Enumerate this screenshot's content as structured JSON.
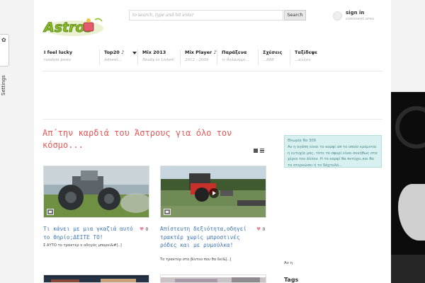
{
  "site": {
    "logo_text": "ASTROS"
  },
  "settings_tab": {
    "label": "Settings",
    "icon": "gear-icon"
  },
  "search": {
    "placeholder": "to search, type and hit enter",
    "button": "Search"
  },
  "account": {
    "signin": "sign in",
    "signin_sub": "comment area",
    "icon": "user-icon"
  },
  "nav": {
    "items": [
      {
        "label": "I feel lucky",
        "sub": "random posts"
      },
      {
        "label": "Top20 ♪",
        "sub": "Advent..."
      },
      {
        "label": "Mix 2013",
        "sub": "Ready to Listen!"
      },
      {
        "label": "Mix Player ♪",
        "sub": "2012 - 2009"
      },
      {
        "label": "Παράξενα",
        "sub": "τι θολάσμρι..."
      },
      {
        "label": "Σχέσεις",
        "sub": "...888"
      },
      {
        "label": "Ταξίδεψε",
        "sub": "...αλλου"
      }
    ]
  },
  "main": {
    "title": "Απ΄την καρδιά του Άστρους για όλο τον κόσμο...",
    "view_icons": [
      "grid-view-icon",
      "list-view-icon"
    ]
  },
  "posts": [
    {
      "title": "Τι κάνει με μια γκαζιά αυτό το θηρίο;ΔΕΙΤΕ ΤΟ!",
      "likes": "0",
      "excerpt": "Σ ΑΥΤΟ το τρακτέρ ο οδηγός μπορεί&#[..]"
    },
    {
      "title": "Απίστευτη δεξιότητα,οδηγεί τρακτέρ χωρίς μπροστινές ρόδες και με ρυμούλκα!",
      "likes": "0",
      "excerpt": "Το τρακτέρ στο βίντεο που θα δεί&[..]"
    }
  ],
  "sidebar": {
    "quote_title": "Θεωρία Νο 309",
    "quote_body": "Αν η αγάπη είναι το καρφί απ το οποίο κρέμεται η ευτυχία μας, τότε το σφυρί είναι συνήθως στα χέρια του άλλου. Η το καρφί θα πετύχει,και θα το στερεώσει ή το δάχτυλό...",
    "note_line": "Αν η",
    "tags_title": "Tags"
  },
  "colors": {
    "accent_red": "#e45a5a",
    "link_blue": "#3d74b8",
    "quote_bg": "#d8f0f0"
  }
}
